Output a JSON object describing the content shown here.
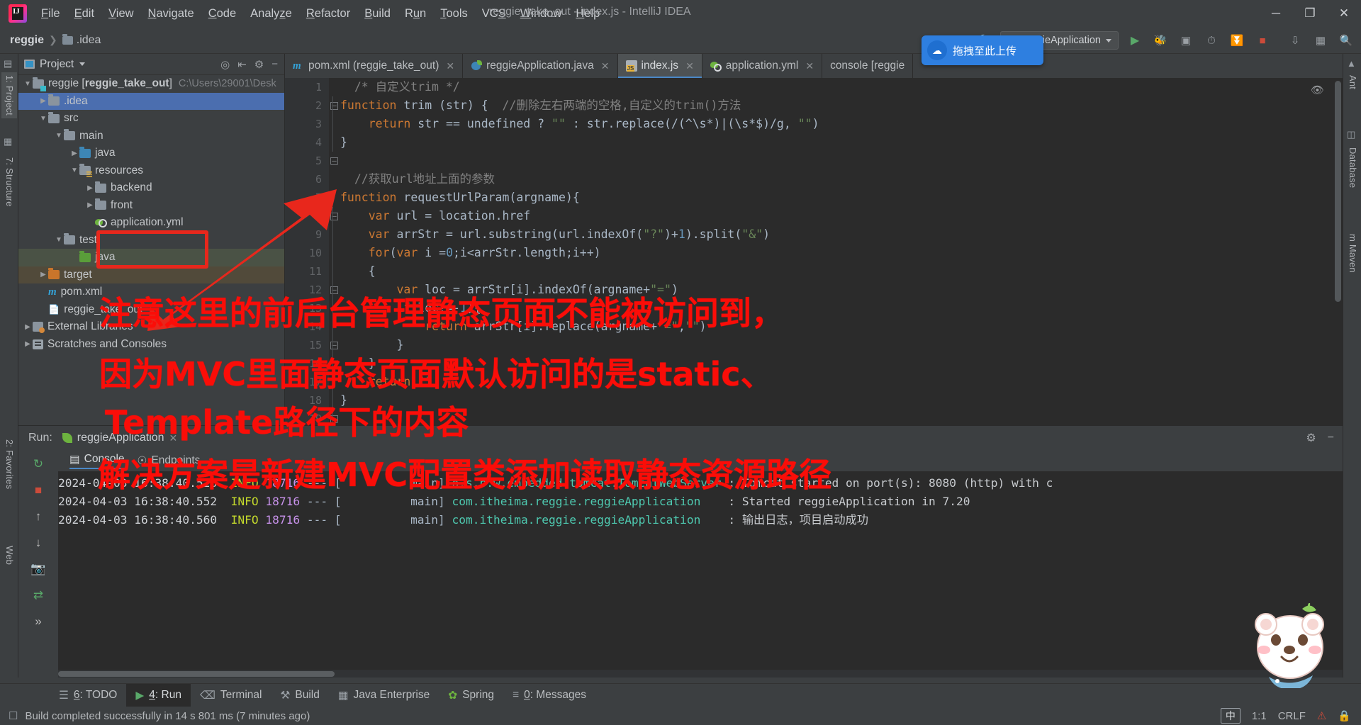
{
  "window": {
    "title": "reggie_take_out - index.js - IntelliJ IDEA",
    "minimize": "─",
    "maximize": "❐",
    "close": "✕"
  },
  "menubar": {
    "items": [
      "File",
      "Edit",
      "View",
      "Navigate",
      "Code",
      "Analyze",
      "Refactor",
      "Build",
      "Run",
      "Tools",
      "VCS",
      "Window",
      "Help"
    ]
  },
  "navbar": {
    "breadcrumb": [
      "reggie",
      ".idea"
    ],
    "run_config": "reggieApplication",
    "upload_button": "拖拽至此上传"
  },
  "left_strip": {
    "tabs": [
      "1: Project",
      "7: Structure"
    ],
    "bottom_tabs": [
      "2: Favorites",
      "Web"
    ]
  },
  "right_strip": {
    "tabs": [
      "Ant",
      "Database",
      "m Maven"
    ]
  },
  "project_panel": {
    "title": "Project",
    "tree": [
      {
        "depth": 0,
        "arrow": "▼",
        "icon": "module",
        "name": "reggie [reggie_take_out]",
        "bold_part": "reggie_take_out",
        "path": "C:\\Users\\29001\\Desk",
        "state": "normal"
      },
      {
        "depth": 1,
        "arrow": "▶",
        "icon": "gray",
        "name": ".idea",
        "path": "",
        "state": "selected"
      },
      {
        "depth": 1,
        "arrow": "▼",
        "icon": "gray",
        "name": "src",
        "path": "",
        "state": "normal"
      },
      {
        "depth": 2,
        "arrow": "▼",
        "icon": "gray",
        "name": "main",
        "path": "",
        "state": "normal"
      },
      {
        "depth": 3,
        "arrow": "▶",
        "icon": "blue",
        "name": "java",
        "path": "",
        "state": "normal"
      },
      {
        "depth": 3,
        "arrow": "▼",
        "icon": "res",
        "name": "resources",
        "path": "",
        "state": "normal"
      },
      {
        "depth": 4,
        "arrow": "▶",
        "icon": "gray",
        "name": "backend",
        "path": "",
        "state": "normal"
      },
      {
        "depth": 4,
        "arrow": "▶",
        "icon": "gray",
        "name": "front",
        "path": "",
        "state": "normal"
      },
      {
        "depth": 4,
        "arrow": "",
        "icon": "yml",
        "name": "application.yml",
        "path": "",
        "state": "normal"
      },
      {
        "depth": 2,
        "arrow": "▼",
        "icon": "gray",
        "name": "test",
        "path": "",
        "state": "normal"
      },
      {
        "depth": 3,
        "arrow": "",
        "icon": "green",
        "name": "java",
        "path": "",
        "state": "green"
      },
      {
        "depth": 1,
        "arrow": "▶",
        "icon": "orange",
        "name": "target",
        "path": "",
        "state": "brown"
      },
      {
        "depth": 1,
        "arrow": "",
        "icon": "maven",
        "name": "pom.xml",
        "path": "",
        "state": "normal"
      },
      {
        "depth": 1,
        "arrow": "",
        "icon": "file",
        "name": "reggie_take_out",
        "path": "",
        "state": "normal"
      },
      {
        "depth": 0,
        "arrow": "▶",
        "icon": "lib",
        "name": "External Libraries",
        "path": "",
        "state": "normal"
      },
      {
        "depth": 0,
        "arrow": "▶",
        "icon": "scr",
        "name": "Scratches and Consoles",
        "path": "",
        "state": "normal"
      }
    ]
  },
  "editor": {
    "tabs": [
      {
        "label": "pom.xml (reggie_take_out)",
        "icon": "maven",
        "active": false,
        "closable": true
      },
      {
        "label": "reggieApplication.java",
        "icon": "spring",
        "active": false,
        "closable": true
      },
      {
        "label": "index.js",
        "icon": "js",
        "active": true,
        "closable": true
      },
      {
        "label": "application.yml",
        "icon": "yml",
        "active": false,
        "closable": true
      },
      {
        "label": "console [reggie",
        "icon": "console",
        "active": false,
        "closable": false
      }
    ],
    "lines": [
      {
        "no": 1,
        "html": "  <span class='cm'>/* 自定义trim */</span>"
      },
      {
        "no": 2,
        "html": "<span class='k'>function</span> <span class='pl'>trim (str) {</span>  <span class='cm'>//删除左右两端的空格,自定义的trim()方法</span>"
      },
      {
        "no": 3,
        "html": "    <span class='k'>return</span> <span class='pl'>str == undefined ? </span><span class='st'>\"\"</span><span class='pl'> : str.replace(/(^\\s*)|(\\s*$)/g, </span><span class='st'>\"\"</span><span class='pl'>)</span>"
      },
      {
        "no": 4,
        "html": "<span class='pl'>}</span>"
      },
      {
        "no": 5,
        "html": ""
      },
      {
        "no": 6,
        "html": "  <span class='cm'>//获取url地址上面的参数</span>"
      },
      {
        "no": 7,
        "html": "<span class='k'>function</span> <span class='pl'>requestUrlParam(argname){</span>"
      },
      {
        "no": 8,
        "html": "    <span class='k'>var</span> <span class='pl'>url = location.href</span>"
      },
      {
        "no": 9,
        "html": "    <span class='k'>var</span> <span class='pl'>arrStr = url.substring(url.indexOf(</span><span class='st'>\"?\"</span><span class='pl'>)+</span><span class='nu'>1</span><span class='pl'>).split(</span><span class='st'>\"&amp;\"</span><span class='pl'>)</span>"
      },
      {
        "no": 10,
        "html": "    <span class='k'>for</span><span class='pl'>(</span><span class='k'>var</span><span class='pl'> i =</span><span class='nu'>0</span><span class='pl'>;i&lt;arrStr.length;i++)</span>"
      },
      {
        "no": 11,
        "html": "    <span class='pl'>{</span>"
      },
      {
        "no": 12,
        "html": "        <span class='k'>var</span> <span class='pl'>loc = arrStr[i].indexOf(argname+</span><span class='st'>\"=\"</span><span class='pl'>)</span>"
      },
      {
        "no": 13,
        "html": "        <span class='k'>if</span><span class='pl'>(loc!=-</span><span class='nu'>1</span><span class='pl'>){</span>"
      },
      {
        "no": 14,
        "html": "            <span class='k'>return</span> <span class='pl'>arrStr[i].replace(argname+</span><span class='st'>\"=\"</span><span class='pl'>,</span><span class='st'>\"\"</span><span class='pl'>)</span>"
      },
      {
        "no": 15,
        "html": "        <span class='pl'>}</span>"
      },
      {
        "no": 16,
        "html": "    <span class='pl'>}</span>"
      },
      {
        "no": 17,
        "html": "    <span class='k'>return</span> <span class='st'>\"\"</span>"
      },
      {
        "no": 18,
        "html": "<span class='pl'>}</span>"
      },
      {
        "no": 19,
        "html": ""
      }
    ]
  },
  "run_panel": {
    "run_label": "Run:",
    "config_name": "reggieApplication",
    "tabs": [
      "Console",
      "Endpoints"
    ],
    "log_lines": [
      {
        "ts": "2024-04-03 16:38:40.526",
        "level": "INFO",
        "pid": "18716",
        "dashes": "--- [",
        "thread": "main]",
        "cls": "o.s.b.w.embedded.tomcat.TomcatWebServer",
        "msg": ": Tomcat started on port(s): 8080 (http) with c"
      },
      {
        "ts": "2024-04-03 16:38:40.552",
        "level": "INFO",
        "pid": "18716",
        "dashes": "--- [",
        "thread": "main]",
        "cls": "com.itheima.reggie.reggieApplication",
        "msg": ": Started reggieApplication in 7.20"
      },
      {
        "ts": "2024-04-03 16:38:40.560",
        "level": "INFO",
        "pid": "18716",
        "dashes": "--- [",
        "thread": "main]",
        "cls": "com.itheima.reggie.reggieApplication",
        "msg": ": 输出日志，项目启动成功"
      }
    ]
  },
  "bottom_bar": {
    "items": [
      {
        "label": "6: TODO",
        "icon": "todo-icon",
        "active": false
      },
      {
        "label": "4: Run",
        "icon": "run-icon",
        "active": true
      },
      {
        "label": "Terminal",
        "icon": "terminal-icon",
        "active": false
      },
      {
        "label": "Build",
        "icon": "build-icon",
        "active": false
      },
      {
        "label": "Java Enterprise",
        "icon": "java-enterprise-icon",
        "active": false
      },
      {
        "label": "Spring",
        "icon": "spring-icon",
        "active": false
      },
      {
        "label": "0: Messages",
        "icon": "messages-icon",
        "active": false
      }
    ]
  },
  "status_bar": {
    "message": "Build completed successfully in 14 s 801 ms (7 minutes ago)",
    "caret": "1:1",
    "line_sep": "CRLF",
    "ime": "中"
  },
  "annotations": {
    "line1": "注意这里的前后台管理静态页面不能被访问到，",
    "line2": "因为MVC里面静态页面默认访问的是static、",
    "line3": "Template路径下的内容",
    "line4": "解决方案是新建MVC配置类添加读取静态资源路径",
    "color": "#fb0d08"
  },
  "colors": {
    "accent": "#4b6eaf",
    "editor_bg": "#2b2b2b",
    "panel_bg": "#3c3f41",
    "annotation_red": "#fb0d08",
    "upload_blue": "#2e7fe0"
  }
}
